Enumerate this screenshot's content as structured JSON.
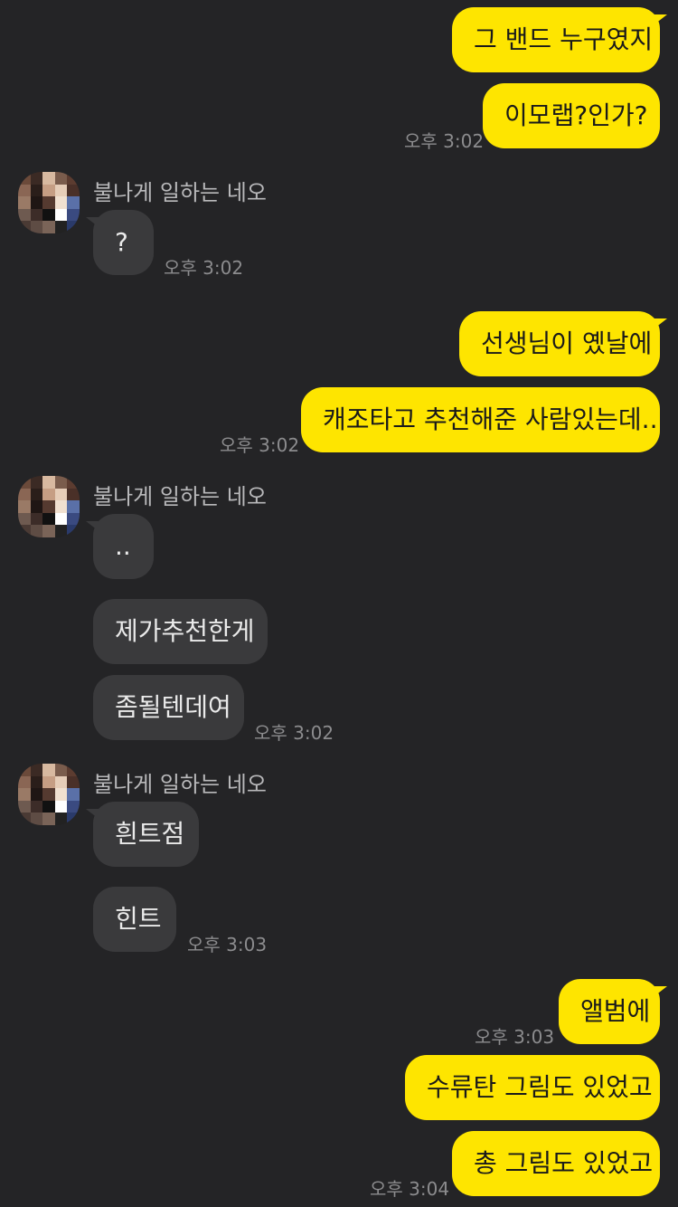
{
  "contact_name": "불나게 일하는 네오",
  "messages": {
    "m1": "그 밴드 누구였지",
    "m2": "이모랩?인가?",
    "t1": "오후 3:02",
    "m3": "?",
    "t2": "오후 3:02",
    "m4": "선생님이 옜날에",
    "m5": "캐조타고 추천해준 사람있는데..",
    "t3": "오후 3:02",
    "m6": "..",
    "m7": "제가추천한게",
    "m8": "좀될텐데여",
    "t4": "오후 3:02",
    "m9": "흰트점",
    "m10": "힌트",
    "t5": "오후 3:03",
    "m11": "앨범에",
    "t6": "오후 3:03",
    "m12": "수류탄 그림도 있었고",
    "m13": "총 그림도 있었고",
    "t7": "오후 3:04"
  },
  "icons": {
    "avatar": "pixelated-profile-avatar"
  },
  "colors": {
    "my_bubble": "#FEE500",
    "their_bubble": "#3a3a3c",
    "background": "#242426"
  }
}
